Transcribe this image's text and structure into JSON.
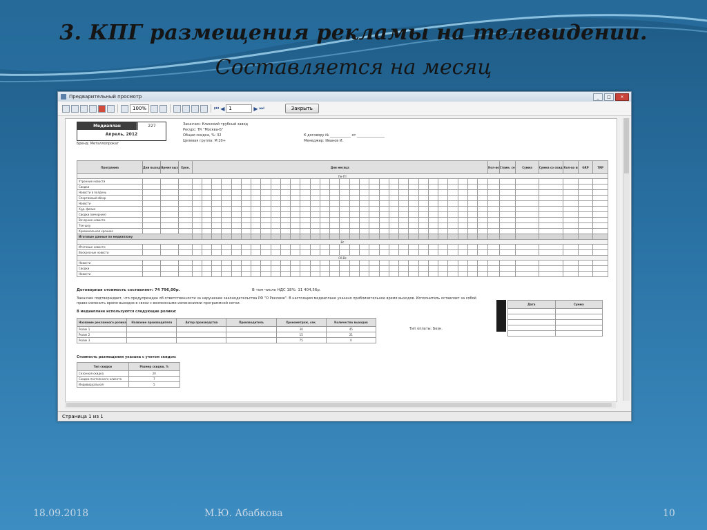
{
  "slide": {
    "title": "3. КПГ размещения рекламы на телевидении.",
    "subtitle": "Составляется на месяц",
    "footer_date": "18.09.2018",
    "footer_author": "М.Ю. Абабкова",
    "footer_page": "10"
  },
  "window": {
    "title": "Предварительный просмотр",
    "zoom": "100%",
    "page_input": "1",
    "close_button": "Закрыть",
    "status": "Страница 1 из 1"
  },
  "report": {
    "mediaplan_label": "Медиаплан",
    "mediaplan_number": "227",
    "month": "Апрель, 2012",
    "brand": "Бренд:  Металлопрокат",
    "customer": "Заказчик:  Клинский трубный завод",
    "resource": "Ресурс:  ТК \"Москва-Б\"",
    "discount": "Общая скидка, %:  32",
    "target_group": "Целевая группа:  М 20+",
    "contract": "К договору № ____________ от ________________",
    "manager": "Менеджер:  Иванов И.",
    "grid_headers": [
      "Программа",
      "Дни выхода",
      "Время выхода",
      "Хрон.",
      "Дни месяца",
      "Кол-во вых.",
      "Стоим. сек.",
      "Сумма",
      "Сумма со скидкой",
      "Кол-во выходов",
      "GRP",
      "TRP"
    ],
    "sections": [
      "Пн-Пт",
      "Вс",
      "Сб-Вс"
    ],
    "programs": [
      "Утренние новости",
      "Сводки",
      "Новости в полдень",
      "Спортивный обзор",
      "Новости",
      "Худ. фильм",
      "Сводки (вечерние)",
      "Вечерние новости",
      "Ток-шоу",
      "Криминальная хроника",
      "Итоговые новости",
      "Воскресные новости",
      "Новости",
      "Сводки",
      "Новости"
    ],
    "total_row": "Итоговые данные по медиаплану",
    "contract_cost": "Договорная стоимость составляет:  74 796,00р.",
    "vat": "В том числе НДС 18%:   11 404,56р.",
    "notice": "Заказчик подтверждает, что предупрежден об ответственности за нарушение законодательства РФ \"О Рекламе\". В настоящем медиаплане указано приблизительное время выходов. Исполнитель оставляет за собой право изменить время выходов в связи с возможными изменениями программной сетки.",
    "rolls_title": "В медиаплане используются следующие ролики:",
    "rolls_headers": [
      "Название рекламного ролика",
      "Название производителя",
      "Автор производства",
      "Производитель",
      "Хронометраж, сек.",
      "Количество выходов"
    ],
    "rolls": [
      [
        "Ролик 1",
        "",
        "",
        "",
        "30",
        "45"
      ],
      [
        "Ролик 2",
        "",
        "",
        "",
        "15",
        "21"
      ],
      [
        "Ролик 3",
        "",
        "",
        "",
        "75",
        "0"
      ]
    ],
    "payment_type": "Тип оплаты:  Безн.",
    "dates_headers": [
      "Дата",
      "Сумма"
    ],
    "discounts_title": "Стоимость размещения указана с учетом скидок:",
    "discount_headers": [
      "Тип скидки",
      "Размер скидки, %"
    ],
    "discount_rows": [
      [
        "Сезонная скидка",
        "20"
      ],
      [
        "Скидка постоянного клиента",
        "7"
      ],
      [
        "Индивидуальная",
        "5"
      ]
    ]
  }
}
